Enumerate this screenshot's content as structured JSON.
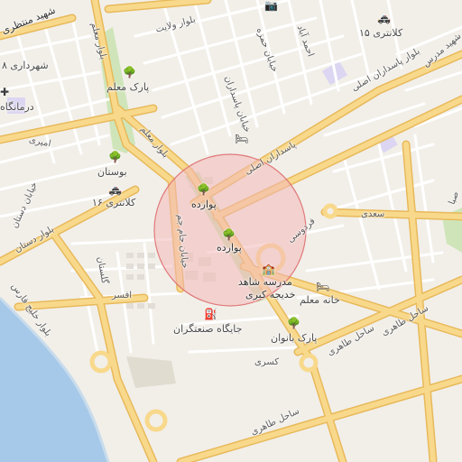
{
  "map": {
    "labels": {
      "shahid_montazeri": "شهید منتظری",
      "shahrdari": "شهرداری ۸",
      "darmangah": "درمانگاه",
      "blvd_velayat": "بلوار ولایت",
      "blvd_moallem": "بلوار معلم",
      "park_moallem": "پارک معلم",
      "kh_hamzeh": "خیابان حمزه",
      "ahmadabad": "احمد آباد",
      "kalantari15": "کلانتری ۱۵",
      "shahid_modarres": "شهید مدرس",
      "kh_pasdaran": "خیابان پاسداران",
      "blvd_pasdaran": "بلوار پاسداران اصلی",
      "pasdaran_asli": "پاسداران اصلی",
      "amiri": "امیری",
      "bustan": "بوستان",
      "kalantari16": "کلانتری ۱۶",
      "kh_dastan": "خیابان دستان",
      "blvd_dastan": "بلوار دستان",
      "kh_jam_jam": "خیابان جام جم",
      "pavardeh1": "پوارده",
      "pavardeh2": "پوارده",
      "ferdowsi": "فردوسی",
      "saadi": "سعدی",
      "madreseh": "مدرسه شاهد",
      "khadijeh": "خدیجه کبری",
      "khaneh_moallem": "خانه معلم",
      "afsar": "افسر",
      "golestan": "گلستان",
      "jaygah": "جایگاه صنعتگران",
      "park_banovan": "پارک بانوان",
      "kasra": "کسری",
      "sahel_taheri1": "ساحل طاهری",
      "sahel_taheri2": "ساحل طاهری",
      "blvd_khalij_fars": "بلوار خلیج فارس",
      "saba": "صبا"
    },
    "icons": {
      "tree": "tree-icon",
      "police": "police-icon",
      "hospital": "hospital-icon",
      "hotel": "hotel-icon",
      "fuel": "fuel-icon",
      "school": "school-icon",
      "camera": "camera-icon"
    },
    "colors": {
      "land": "#f2efe9",
      "road_major": "#f8d98c",
      "road_major_casing": "#e8b95a",
      "road_minor": "#ffffff",
      "water": "#a7c9e9",
      "park": "#cfe5b9",
      "highlight_fill": "#f2b8b8",
      "highlight_stroke": "#e07a7a",
      "building": "#e2ddd6",
      "purple_area": "#dcd6f2"
    }
  }
}
